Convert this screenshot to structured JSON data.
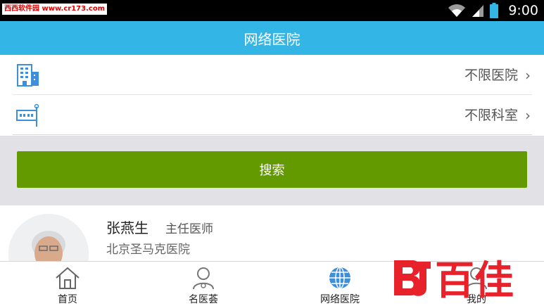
{
  "statusbar": {
    "watermark": "西西软件园 www.cr173.com",
    "time": "9:00"
  },
  "header": {
    "title": "网络医院"
  },
  "filters": [
    {
      "icon": "hospital-building-icon",
      "value": "不限医院"
    },
    {
      "icon": "department-sign-icon",
      "value": "不限科室"
    }
  ],
  "search": {
    "label": "搜索",
    "button_color": "#629a00"
  },
  "doctor": {
    "name": "张燕生",
    "title": "主任医师",
    "hospital": "北京圣马克医院"
  },
  "nav": {
    "items": [
      {
        "label": "首页",
        "icon": "home-icon"
      },
      {
        "label": "名医荟",
        "icon": "doctor-icon"
      },
      {
        "label": "网络医院",
        "icon": "globe-icon",
        "active": true
      },
      {
        "label": "我的",
        "icon": "profile-icon"
      }
    ]
  },
  "watermark_logo": "百佳",
  "colors": {
    "header": "#33b5e5",
    "icon_blue": "#3d8fd9",
    "band": "#e2e2e6",
    "logo_red": "#e8222a"
  }
}
